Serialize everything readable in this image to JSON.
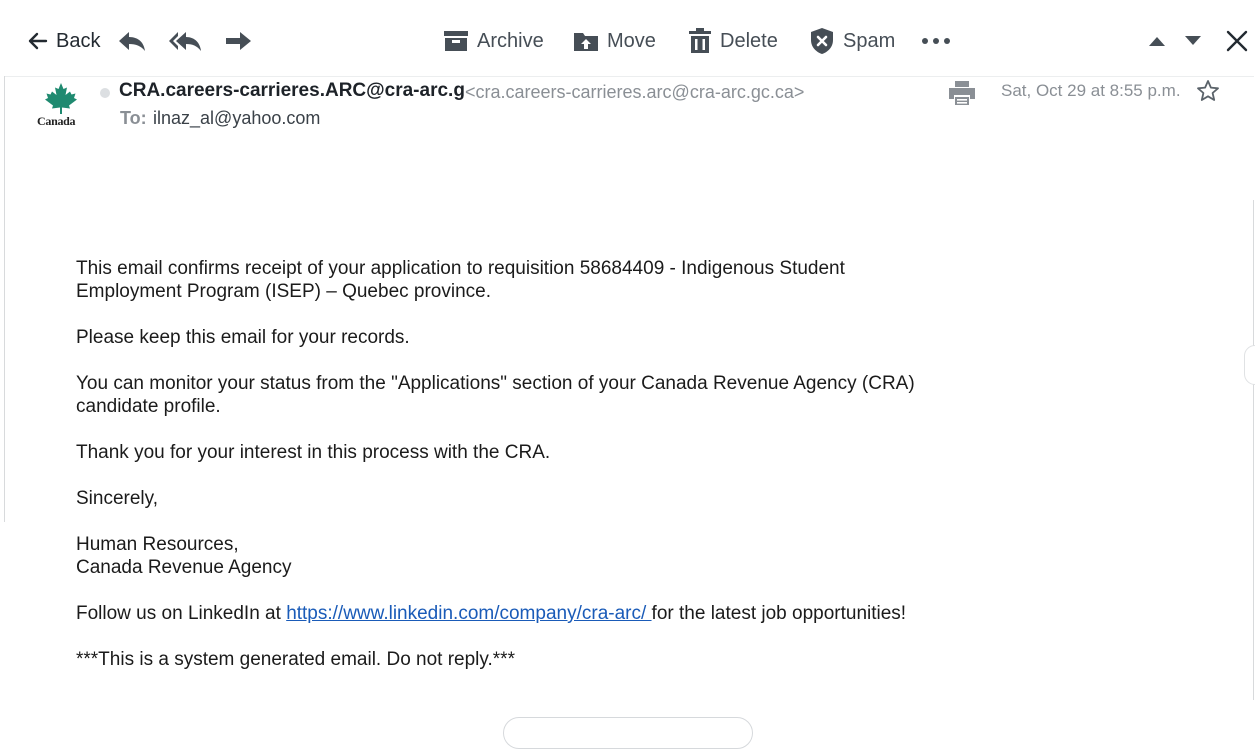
{
  "toolbar": {
    "back_label": "Back",
    "archive_label": "Archive",
    "move_label": "Move",
    "delete_label": "Delete",
    "spam_label": "Spam"
  },
  "message": {
    "logo_text": "Canada",
    "sender_name": "CRA.careers-carrieres.ARC@cra-arc.g",
    "sender_email": "<cra.careers-carrieres.arc@cra-arc.gc.ca>",
    "to_label": "To:",
    "to_value": "ilnaz_al@yahoo.com",
    "date": "Sat, Oct 29 at 8:55 p.m."
  },
  "body": {
    "p1_line1": "This email confirms receipt of your application to requisition 58684409 - Indigenous Student",
    "p1_line2": "Employment Program (ISEP) – Quebec province.",
    "p2": "Please keep this email for your records.",
    "p3_line1": "You can monitor your status from the \"Applications\" section of your Canada Revenue Agency (CRA)",
    "p3_line2": "candidate profile.",
    "p4": "Thank you for your interest in this process with the CRA.",
    "p5": "Sincerely,",
    "p6_line1": "Human Resources,",
    "p6_line2": "Canada Revenue Agency",
    "p7_before": "Follow us on LinkedIn at ",
    "p7_link": "https://www.linkedin.com/company/cra-arc/ ",
    "p7_after": "for the latest job opportunities!",
    "p8": "***This is a system generated email. Do not reply.***"
  },
  "colors": {
    "link": "#1a5bb8",
    "maple_red": "#d52b1e",
    "logo_teal": "#1f8a70"
  }
}
